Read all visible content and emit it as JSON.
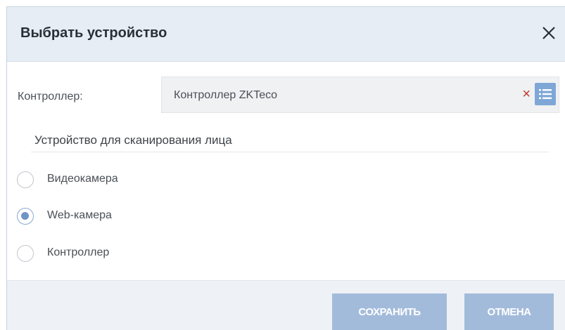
{
  "dialog": {
    "title": "Выбрать устройство"
  },
  "controller_field": {
    "label": "Контроллер:",
    "value": "Контроллер ZKTeco"
  },
  "section": {
    "title": "Устройство для сканирования лица"
  },
  "options": [
    {
      "label": "Видеокамера",
      "checked": false
    },
    {
      "label": "Web-камера",
      "checked": true
    },
    {
      "label": "Контроллер",
      "checked": false
    }
  ],
  "footer": {
    "save_label": "СОХРАНИТЬ",
    "cancel_label": "ОТМЕНА"
  },
  "icons": {
    "close": "close-icon",
    "clear": "clear-icon",
    "list": "list-icon"
  },
  "colors": {
    "header_bg": "#e6edf5",
    "button_bg": "#a3bbdb",
    "accent": "#6f95c6",
    "clear": "#c0392b"
  }
}
